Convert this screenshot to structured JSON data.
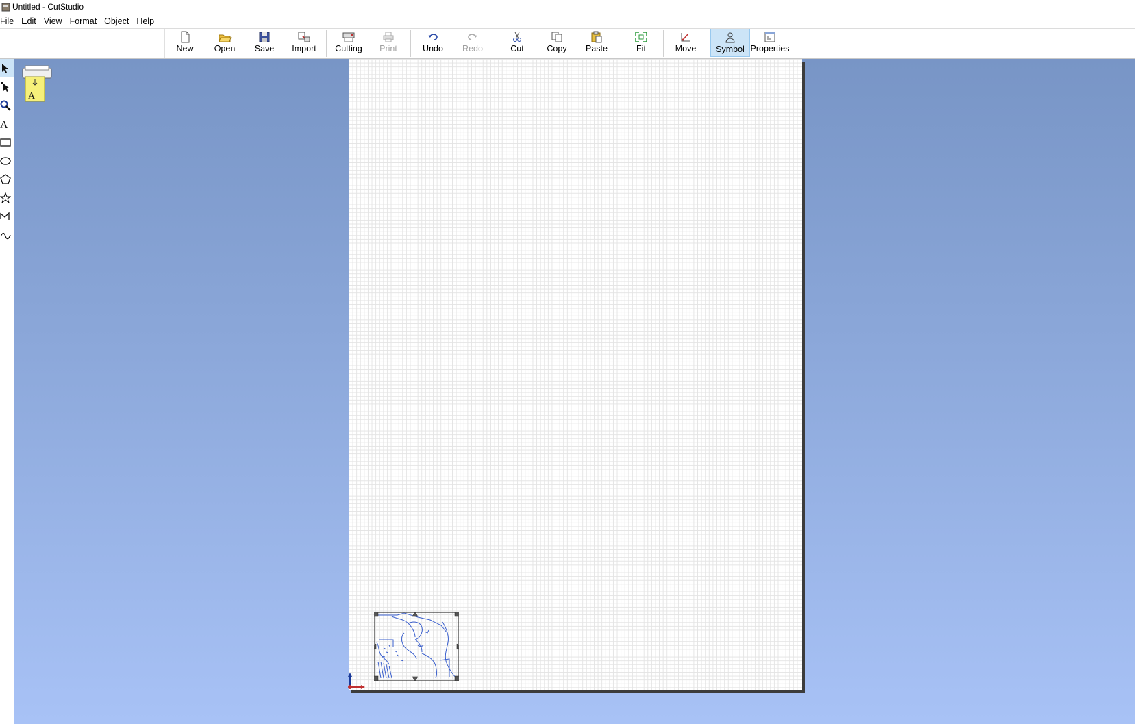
{
  "window": {
    "title": "Untitled - CutStudio"
  },
  "menu": [
    "File",
    "Edit",
    "View",
    "Format",
    "Object",
    "Help"
  ],
  "toolbar": [
    {
      "label": "New",
      "icon": "new-document-icon"
    },
    {
      "label": "Open",
      "icon": "open-folder-icon"
    },
    {
      "label": "Save",
      "icon": "save-disk-icon"
    },
    {
      "label": "Import",
      "icon": "import-icon"
    },
    {
      "label": "Cutting",
      "icon": "cutting-plotter-icon"
    },
    {
      "label": "Print",
      "icon": "printer-icon",
      "disabled": true
    },
    {
      "label": "Undo",
      "icon": "undo-icon"
    },
    {
      "label": "Redo",
      "icon": "redo-icon",
      "disabled": true
    },
    {
      "label": "Cut",
      "icon": "scissors-icon"
    },
    {
      "label": "Copy",
      "icon": "copy-icon"
    },
    {
      "label": "Paste",
      "icon": "paste-icon"
    },
    {
      "label": "Fit",
      "icon": "fit-icon"
    },
    {
      "label": "Move",
      "icon": "move-icon"
    },
    {
      "label": "Symbol",
      "icon": "symbol-icon",
      "active": true
    },
    {
      "label": "Properties",
      "icon": "properties-icon"
    }
  ],
  "tools": [
    "select-arrow-icon",
    "node-edit-icon",
    "zoom-icon",
    "text-icon",
    "rectangle-icon",
    "ellipse-icon",
    "polygon-icon",
    "star-icon",
    "polyline-icon",
    "curve-icon"
  ],
  "colors": {
    "workspace_top": "#7895c6",
    "workspace_bottom": "#a8c2f6",
    "selection_active_bg": "#cce4f7",
    "artwork_stroke": "#3a5fcd"
  }
}
